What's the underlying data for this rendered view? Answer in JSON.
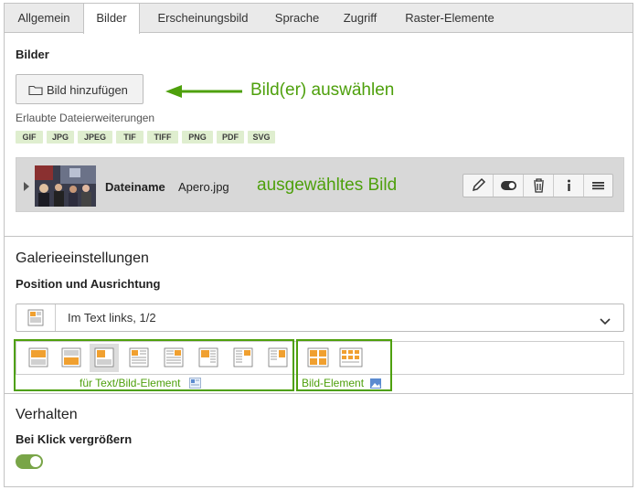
{
  "tabs": [
    {
      "label": "Allgemein",
      "active": false
    },
    {
      "label": "Bilder",
      "active": true
    },
    {
      "label": "Erscheinungsbild",
      "active": false
    },
    {
      "label": "Sprache",
      "active": false
    },
    {
      "label": "Zugriff",
      "active": false
    },
    {
      "label": "Raster-Elemente",
      "active": false
    }
  ],
  "images_section": {
    "title": "Bilder",
    "add_button_label": "Bild hinzufügen",
    "add_button_icon": "folder-icon",
    "annotation_add": "Bild(er) auswählen",
    "allowed_label": "Erlaubte Dateierweiterungen",
    "extensions": [
      "GIF",
      "JPG",
      "JPEG",
      "TIF",
      "TIFF",
      "PNG",
      "PDF",
      "SVG"
    ]
  },
  "file": {
    "name_label": "Dateiname",
    "name_value": "Apero.jpg",
    "annotation": "ausgewähltes Bild",
    "actions": [
      "edit-icon",
      "toggle-visibility-icon",
      "delete-icon",
      "info-icon",
      "menu-icon"
    ]
  },
  "gallery": {
    "heading": "Galerieeinstellungen",
    "position_label": "Position und Ausrichtung",
    "position_value": "Im Text links, 1/2",
    "caption_text_image": "für Text/Bild-Element",
    "caption_image": "Bild-Element"
  },
  "behavior": {
    "heading": "Verhalten",
    "zoom_label": "Bei Klick vergrößern",
    "zoom_enabled": true
  },
  "colors": {
    "annotation_green": "#4ea00c",
    "badge_bg": "#dfeecf",
    "toggle_on": "#79a548"
  }
}
